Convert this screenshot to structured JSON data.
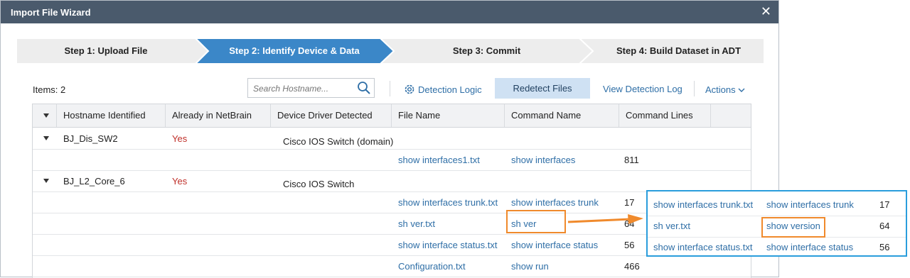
{
  "dialog": {
    "title": "Import File Wizard",
    "close_glyph": "✕"
  },
  "steps": [
    {
      "label": "Step 1: Upload File",
      "active": false
    },
    {
      "label": "Step 2: Identify Device & Data",
      "active": true
    },
    {
      "label": "Step 3: Commit",
      "active": false
    },
    {
      "label": "Step 4: Build Dataset in ADT",
      "active": false
    }
  ],
  "toolbar": {
    "items_label": "Items: 2",
    "search_placeholder": "Search Hostname...",
    "detection_logic": "Detection Logic",
    "redetect_files": "Redetect Files",
    "view_detection_log": "View Detection Log",
    "actions": "Actions"
  },
  "table": {
    "headers": [
      "Hostname Identified",
      "Already in NetBrain",
      "Device Driver Detected",
      "File Name",
      "Command Name",
      "Command Lines"
    ],
    "groups": [
      {
        "hostname": "BJ_Dis_SW2",
        "in_netbrain": "Yes",
        "driver": "Cisco IOS Switch (domain)",
        "files": [
          {
            "file": "show interfaces1.txt",
            "command": "show interfaces",
            "lines": "811"
          }
        ]
      },
      {
        "hostname": "BJ_L2_Core_6",
        "in_netbrain": "Yes",
        "driver": "Cisco IOS Switch",
        "files": [
          {
            "file": "show interfaces trunk.txt",
            "command": "show interfaces trunk",
            "lines": "17"
          },
          {
            "file": "sh ver.txt",
            "command": "sh ver",
            "lines": "64"
          },
          {
            "file": "show interface status.txt",
            "command": "show interface status",
            "lines": "56"
          },
          {
            "file": "Configuration.txt",
            "command": "show run",
            "lines": "466"
          }
        ]
      }
    ]
  },
  "callout": {
    "rows": [
      {
        "file": "show interfaces trunk.txt",
        "command": "show interfaces trunk",
        "lines": "17"
      },
      {
        "file": "sh ver.txt",
        "command": "show version",
        "lines": "64"
      },
      {
        "file": "show interface status.txt",
        "command": "show interface status",
        "lines": "56"
      }
    ]
  },
  "colors": {
    "titlebar": "#4a5a6c",
    "active_step": "#3b87c8",
    "link": "#2e6ea6",
    "yes": "#c0302a",
    "highlight_orange": "#f08a2c",
    "callout_blue": "#2a9ddc"
  }
}
